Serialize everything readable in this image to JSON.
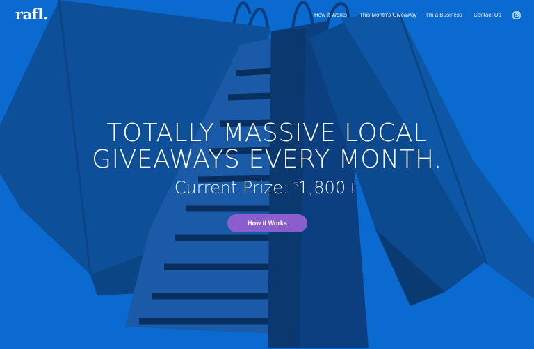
{
  "header": {
    "logo": "rafl.",
    "nav": {
      "how_it_works": "How it Works",
      "giveaway": "This Month's Giveaway",
      "business": "I'm a Business",
      "contact": "Contact Us"
    },
    "social_icon": "instagram-icon"
  },
  "hero": {
    "headline_line1": "TOTALLY MASSIVE LOCAL",
    "headline_line2": "GIVEAWAYS EVERY MONTH.",
    "prize_label": "Current Prize:",
    "prize_currency": "$",
    "prize_amount": "1,800+",
    "cta_label": "How it Works",
    "background_image": "shopping-bags-photo"
  },
  "colors": {
    "background": "#0a6ad0",
    "cta": "#8a5ecc",
    "text": "#ffffff"
  }
}
